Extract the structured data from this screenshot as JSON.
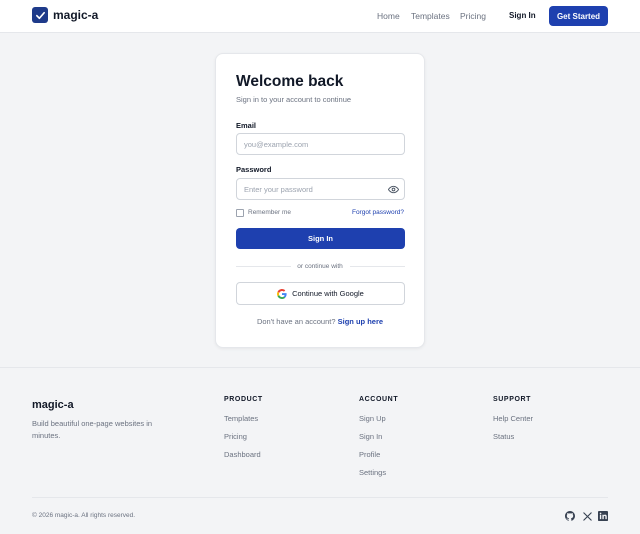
{
  "header": {
    "brand": "magic-a",
    "nav": [
      "Home",
      "Templates",
      "Pricing"
    ],
    "signin_label": "Sign In",
    "cta_label": "Get Started"
  },
  "login": {
    "title": "Welcome back",
    "subtitle": "Sign in to your account to continue",
    "email_label": "Email",
    "email_placeholder": "you@example.com",
    "password_label": "Password",
    "password_placeholder": "Enter your password",
    "remember_label": "Remember me",
    "forgot_label": "Forgot password?",
    "submit_label": "Sign In",
    "divider_label": "or continue with",
    "google_label": "Continue with Google",
    "signup_prompt": "Don't have an account?",
    "signup_link": "Sign up here"
  },
  "footer": {
    "brand": "magic-a",
    "tagline": "Build beautiful one-page websites in minutes.",
    "columns": [
      {
        "heading": "PRODUCT",
        "links": [
          "Templates",
          "Pricing",
          "Dashboard"
        ]
      },
      {
        "heading": "ACCOUNT",
        "links": [
          "Sign Up",
          "Sign In",
          "Profile",
          "Settings"
        ]
      },
      {
        "heading": "SUPPORT",
        "links": [
          "Help Center",
          "Status"
        ]
      }
    ],
    "copyright": "© 2026 magic-a. All rights reserved.",
    "social_icons": [
      "github-icon",
      "x-icon",
      "linkedin-icon"
    ]
  },
  "colors": {
    "primary": "#1e40af",
    "brand_dark": "#1e3a8a",
    "background": "#f3f4f6",
    "muted_text": "#6b7280"
  }
}
